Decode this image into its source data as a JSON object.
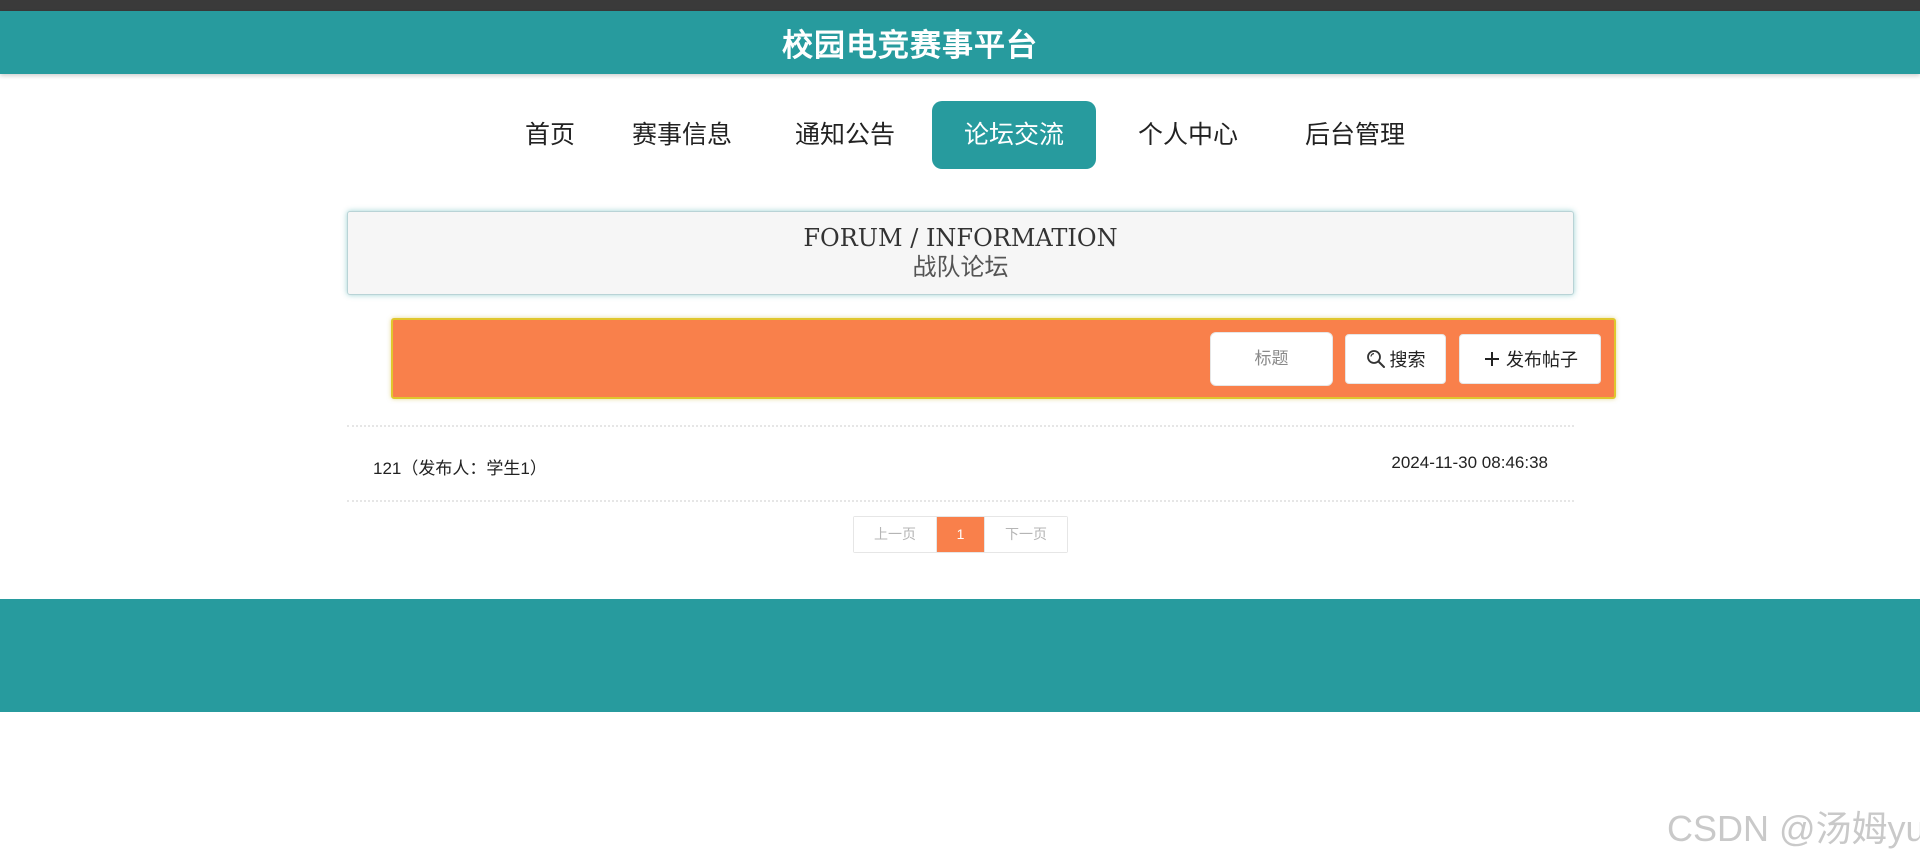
{
  "header": {
    "title": "校园电竞赛事平台"
  },
  "nav": {
    "items": [
      {
        "label": "首页"
      },
      {
        "label": "赛事信息"
      },
      {
        "label": "通知公告"
      },
      {
        "label": "论坛交流"
      },
      {
        "label": "个人中心"
      },
      {
        "label": "后台管理"
      }
    ],
    "active": "论坛交流"
  },
  "forum": {
    "title_en": "FORUM / INFORMATION",
    "title_cn": "战队论坛"
  },
  "toolbar": {
    "search_placeholder": "标题",
    "search_label": "搜索",
    "publish_label": "发布帖子"
  },
  "posts": [
    {
      "title": "121（发布人：学生1）",
      "time": "2024-11-30 08:46:38"
    }
  ],
  "pager": {
    "prev": "上一页",
    "current": "1",
    "next": "下一页"
  },
  "watermark": "CSDN @汤姆yu",
  "colors": {
    "primary": "#279b9e",
    "accent": "#f9804b",
    "toolbar_border": "#e0c62e",
    "topbar": "#3a3a3a"
  },
  "icons": {
    "search": "magnifier-icon",
    "publish": "plus-icon"
  }
}
